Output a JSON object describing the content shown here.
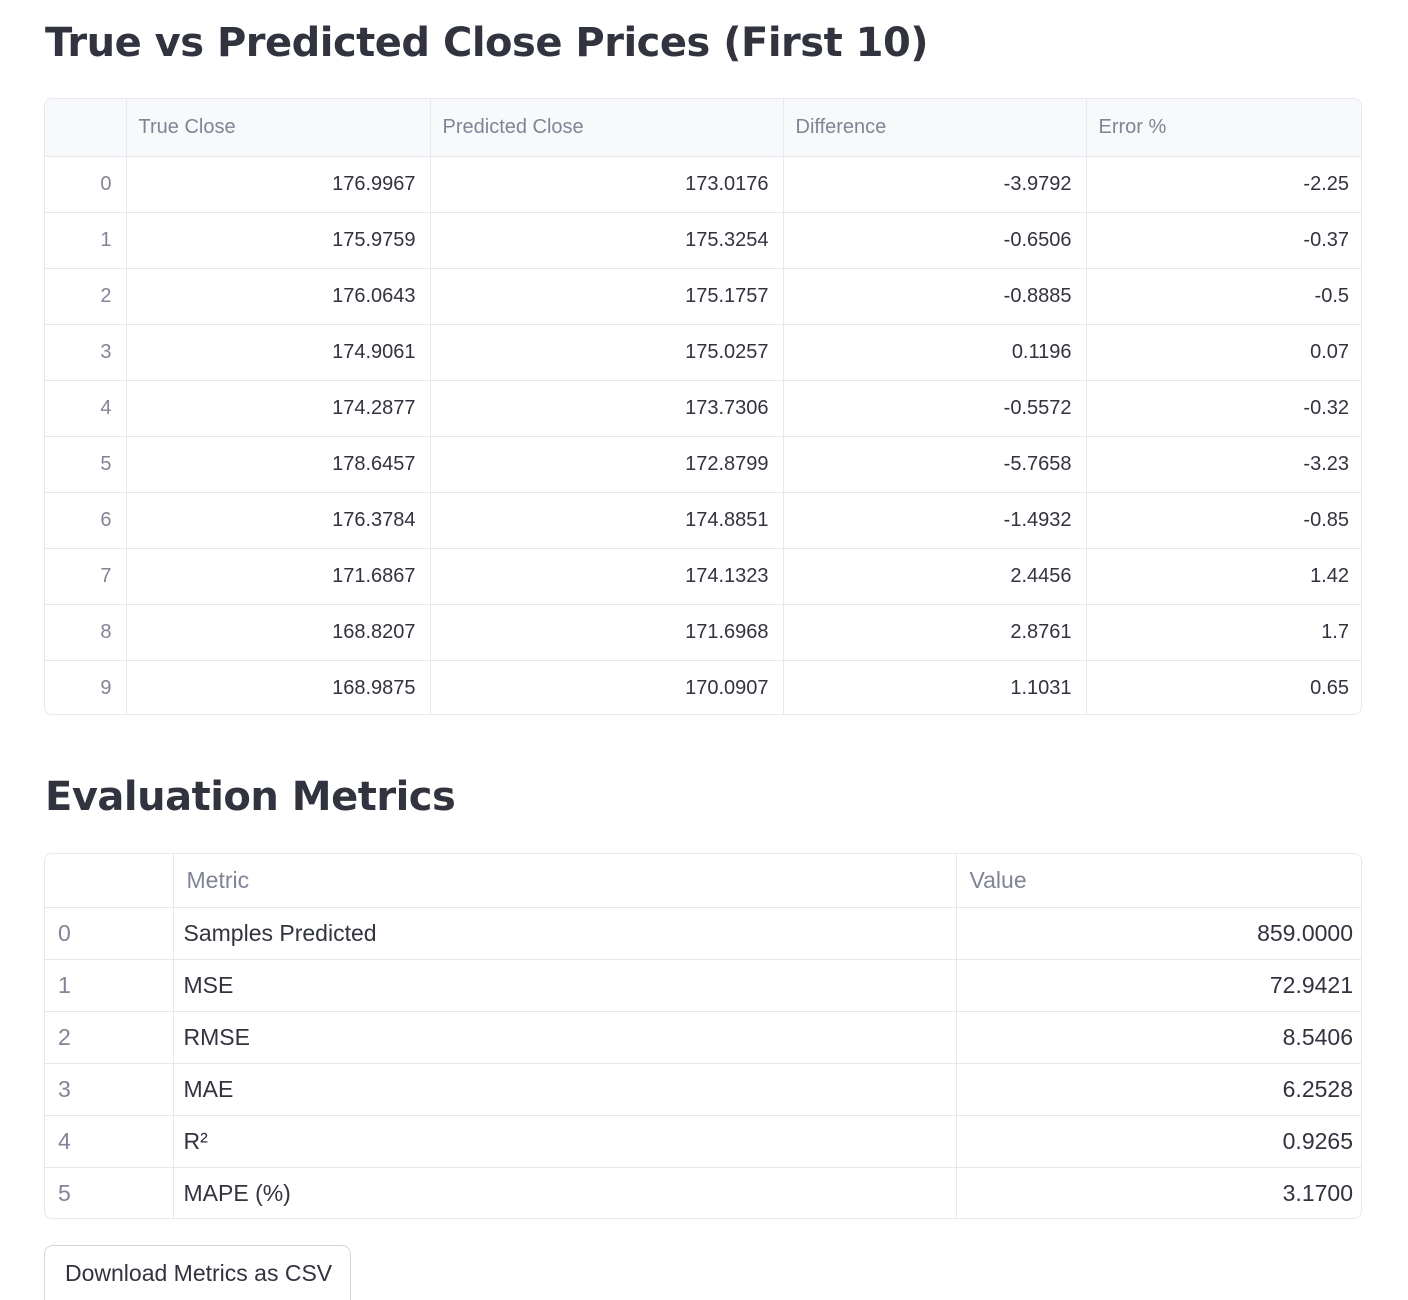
{
  "predictions": {
    "title": "True vs Predicted Close Prices (First 10)",
    "columns": [
      "True Close",
      "Predicted Close",
      "Difference",
      "Error %"
    ],
    "rows": [
      {
        "index": "0",
        "true_close": "176.9967",
        "predicted_close": "173.0176",
        "difference": "-3.9792",
        "error_pct": "-2.25"
      },
      {
        "index": "1",
        "true_close": "175.9759",
        "predicted_close": "175.3254",
        "difference": "-0.6506",
        "error_pct": "-0.37"
      },
      {
        "index": "2",
        "true_close": "176.0643",
        "predicted_close": "175.1757",
        "difference": "-0.8885",
        "error_pct": "-0.5"
      },
      {
        "index": "3",
        "true_close": "174.9061",
        "predicted_close": "175.0257",
        "difference": "0.1196",
        "error_pct": "0.07"
      },
      {
        "index": "4",
        "true_close": "174.2877",
        "predicted_close": "173.7306",
        "difference": "-0.5572",
        "error_pct": "-0.32"
      },
      {
        "index": "5",
        "true_close": "178.6457",
        "predicted_close": "172.8799",
        "difference": "-5.7658",
        "error_pct": "-3.23"
      },
      {
        "index": "6",
        "true_close": "176.3784",
        "predicted_close": "174.8851",
        "difference": "-1.4932",
        "error_pct": "-0.85"
      },
      {
        "index": "7",
        "true_close": "171.6867",
        "predicted_close": "174.1323",
        "difference": "2.4456",
        "error_pct": "1.42"
      },
      {
        "index": "8",
        "true_close": "168.8207",
        "predicted_close": "171.6968",
        "difference": "2.8761",
        "error_pct": "1.7"
      },
      {
        "index": "9",
        "true_close": "168.9875",
        "predicted_close": "170.0907",
        "difference": "1.1031",
        "error_pct": "0.65"
      }
    ]
  },
  "metrics": {
    "title": "Evaluation Metrics",
    "columns": [
      "Metric",
      "Value"
    ],
    "rows": [
      {
        "index": "0",
        "metric": "Samples Predicted",
        "value": "859.0000"
      },
      {
        "index": "1",
        "metric": "MSE",
        "value": "72.9421"
      },
      {
        "index": "2",
        "metric": "RMSE",
        "value": "8.5406"
      },
      {
        "index": "3",
        "metric": "MAE",
        "value": "6.2528"
      },
      {
        "index": "4",
        "metric": "R²",
        "value": "0.9265"
      },
      {
        "index": "5",
        "metric": "MAPE (%)",
        "value": "3.1700"
      }
    ]
  },
  "download_button": {
    "label": "Download Metrics as CSV"
  },
  "colors": {
    "text": "#31333f",
    "muted_text": "#808495",
    "border": "#e6e8ee",
    "header_bg": "#f8f9fb"
  }
}
